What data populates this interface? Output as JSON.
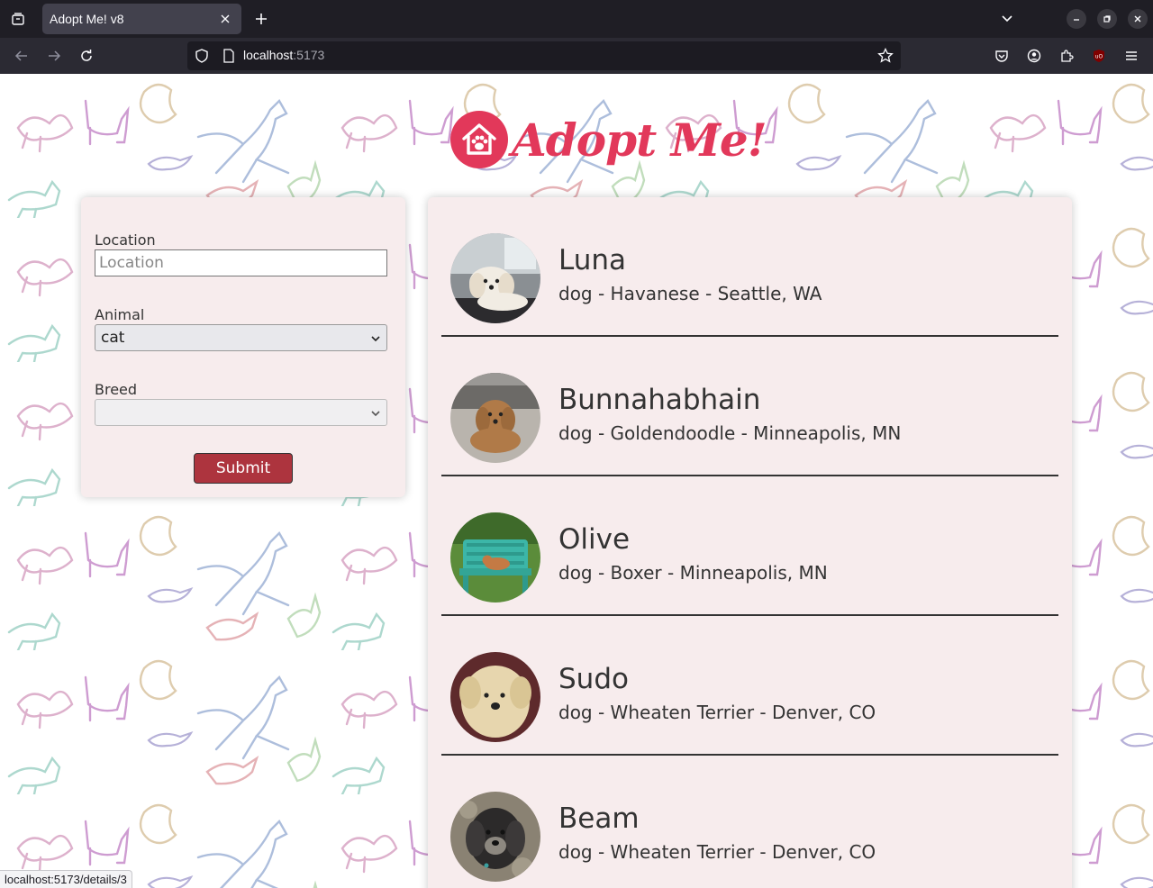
{
  "browser": {
    "tab_title": "Adopt Me! v8",
    "url_host": "localhost",
    "url_port": ":5173",
    "status_url": "localhost:5173/details/3"
  },
  "app": {
    "logo_text": "Adopt Me!",
    "brand_color": "#e2385a",
    "panel_color": "#f7eced",
    "button_color": "#ad343e"
  },
  "search": {
    "location_label": "Location",
    "location_placeholder": "Location",
    "location_value": "",
    "animal_label": "Animal",
    "animal_value": "cat",
    "breed_label": "Breed",
    "breed_value": "",
    "submit_label": "Submit"
  },
  "pets": [
    {
      "name": "Luna",
      "description": "dog - Havanese - Seattle, WA"
    },
    {
      "name": "Bunnahabhain",
      "description": "dog - Goldendoodle - Minneapolis, MN"
    },
    {
      "name": "Olive",
      "description": "dog - Boxer - Minneapolis, MN"
    },
    {
      "name": "Sudo",
      "description": "dog - Wheaten Terrier - Denver, CO"
    },
    {
      "name": "Beam",
      "description": "dog - Wheaten Terrier - Denver, CO"
    }
  ]
}
